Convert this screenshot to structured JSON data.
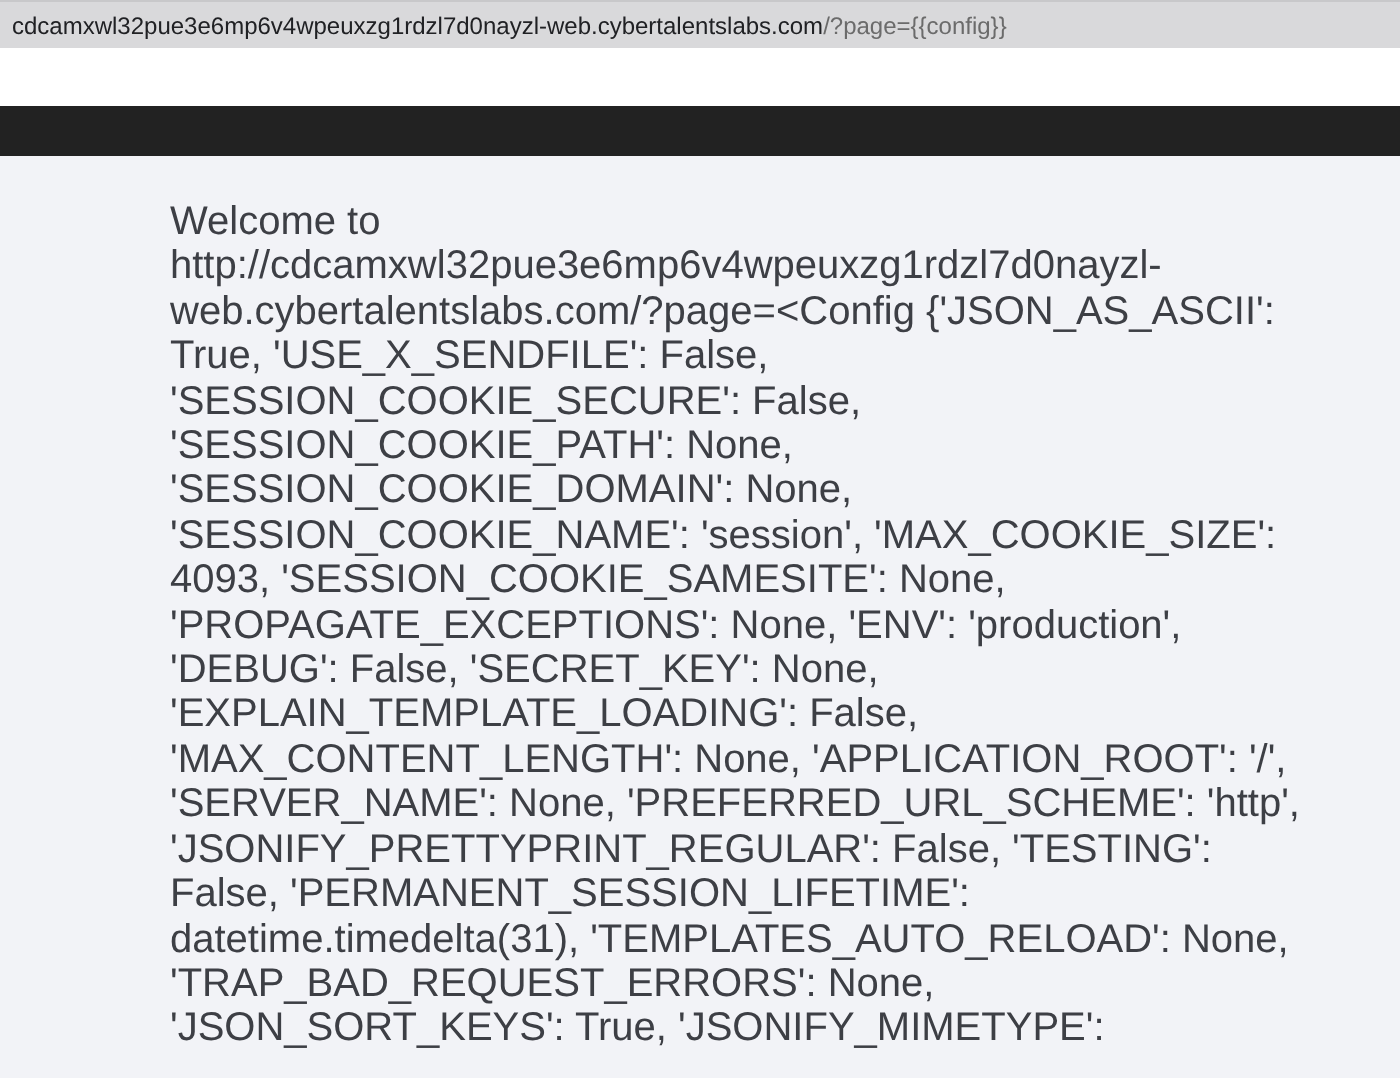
{
  "address_bar": {
    "host": "cdcamxwl32pue3e6mp6v4wpeuxzg1rdzl7d0nayzl-web.cybertalentslabs.com",
    "path": "/?page={{config}}"
  },
  "message": "Welcome to http://cdcamxwl32pue3e6mp6v4wpeuxzg1rdzl7d0nayzl-web.cybertalentslabs.com/?page=<Config {'JSON_AS_ASCII': True, 'USE_X_SENDFILE': False, 'SESSION_COOKIE_SECURE': False, 'SESSION_COOKIE_PATH': None, 'SESSION_COOKIE_DOMAIN': None, 'SESSION_COOKIE_NAME': 'session', 'MAX_COOKIE_SIZE': 4093, 'SESSION_COOKIE_SAMESITE': None, 'PROPAGATE_EXCEPTIONS': None, 'ENV': 'production', 'DEBUG': False, 'SECRET_KEY': None, 'EXPLAIN_TEMPLATE_LOADING': False, 'MAX_CONTENT_LENGTH': None, 'APPLICATION_ROOT': '/', 'SERVER_NAME': None, 'PREFERRED_URL_SCHEME': 'http', 'JSONIFY_PRETTYPRINT_REGULAR': False, 'TESTING': False, 'PERMANENT_SESSION_LIFETIME': datetime.timedelta(31), 'TEMPLATES_AUTO_RELOAD': None, 'TRAP_BAD_REQUEST_ERRORS': None, 'JSON_SORT_KEYS': True, 'JSONIFY_MIMETYPE':"
}
